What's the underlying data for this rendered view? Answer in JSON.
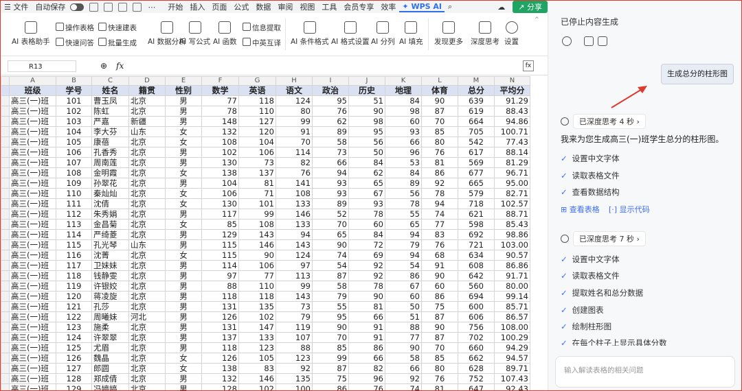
{
  "menubar": {
    "file": "文件",
    "autosave": "自动保存",
    "tabs": [
      "开始",
      "插入",
      "页面",
      "公式",
      "数据",
      "审阅",
      "视图",
      "工具",
      "会员专享",
      "效率"
    ],
    "wps_ai": "WPS AI",
    "share": "分享"
  },
  "ribbon": {
    "ai_table_assistant": "AI 表格助手",
    "operate_table": "操作表格",
    "quick_table": "快速建表",
    "quick_qa": "快速问答",
    "batch_generate": "批量生成",
    "ai_data_analysis": "AI 数据分析",
    "ai_formula": "AI 写公式",
    "ai_function": "AI 函数",
    "info_extract": "信息提取",
    "cn_en_translate": "中英互译",
    "ai_conditional_format": "AI 条件格式",
    "ai_format_setting": "AI 格式设置",
    "ai_split_column": "AI 分列",
    "ai_fill": "AI 填充",
    "discover_more": "发现更多",
    "deep_think": "深度思考",
    "beta": "Beta",
    "settings": "设置"
  },
  "formula_bar": {
    "cell_ref": "R13",
    "fx": "fx",
    "value": ""
  },
  "sheet": {
    "columns": [
      "A",
      "B",
      "C",
      "D",
      "E",
      "F",
      "G",
      "H",
      "I",
      "J",
      "K",
      "L",
      "M",
      "N"
    ],
    "headers": [
      "班级",
      "学号",
      "姓名",
      "籍贯",
      "性别",
      "数学",
      "英语",
      "语文",
      "政治",
      "历史",
      "地理",
      "体育",
      "总分",
      "平均分"
    ],
    "rows": [
      [
        "高三(一)班",
        "101",
        "曹玉凤",
        "北京",
        "男",
        "77",
        "118",
        "124",
        "95",
        "51",
        "84",
        "90",
        "639",
        "91.29"
      ],
      [
        "高三(一)班",
        "102",
        "陈虹",
        "北京",
        "男",
        "78",
        "110",
        "80",
        "76",
        "90",
        "98",
        "87",
        "619",
        "88.43"
      ],
      [
        "高三(一)班",
        "103",
        "严嘉",
        "新疆",
        "男",
        "148",
        "127",
        "99",
        "62",
        "98",
        "60",
        "70",
        "664",
        "94.86"
      ],
      [
        "高三(一)班",
        "104",
        "李大芬",
        "山东",
        "女",
        "132",
        "120",
        "91",
        "89",
        "95",
        "93",
        "85",
        "705",
        "100.71"
      ],
      [
        "高三(一)班",
        "105",
        "康蓓",
        "北京",
        "女",
        "108",
        "104",
        "70",
        "58",
        "56",
        "66",
        "80",
        "542",
        "77.43"
      ],
      [
        "高三(一)班",
        "106",
        "孔香秀",
        "北京",
        "男",
        "102",
        "106",
        "114",
        "73",
        "50",
        "96",
        "76",
        "617",
        "88.14"
      ],
      [
        "高三(一)班",
        "107",
        "周南莲",
        "北京",
        "男",
        "130",
        "73",
        "82",
        "66",
        "84",
        "53",
        "81",
        "569",
        "81.29"
      ],
      [
        "高三(一)班",
        "108",
        "金明霞",
        "北京",
        "女",
        "138",
        "137",
        "76",
        "94",
        "62",
        "84",
        "86",
        "677",
        "96.71"
      ],
      [
        "高三(一)班",
        "109",
        "孙翠花",
        "北京",
        "男",
        "104",
        "81",
        "141",
        "93",
        "65",
        "89",
        "92",
        "665",
        "95.00"
      ],
      [
        "高三(一)班",
        "110",
        "秦灿灿",
        "北京",
        "女",
        "106",
        "71",
        "108",
        "93",
        "67",
        "56",
        "78",
        "579",
        "82.71"
      ],
      [
        "高三(一)班",
        "111",
        "沈倩",
        "北京",
        "女",
        "130",
        "101",
        "133",
        "89",
        "93",
        "78",
        "94",
        "718",
        "102.57"
      ],
      [
        "高三(一)班",
        "112",
        "朱秀娟",
        "北京",
        "男",
        "117",
        "99",
        "146",
        "52",
        "78",
        "55",
        "74",
        "621",
        "88.71"
      ],
      [
        "高三(一)班",
        "113",
        "金昌菊",
        "北京",
        "女",
        "85",
        "108",
        "133",
        "70",
        "60",
        "65",
        "77",
        "598",
        "85.43"
      ],
      [
        "高三(一)班",
        "114",
        "严绮菱",
        "北京",
        "男",
        "129",
        "143",
        "94",
        "65",
        "84",
        "94",
        "83",
        "692",
        "98.86"
      ],
      [
        "高三(一)班",
        "115",
        "孔光琴",
        "山东",
        "男",
        "115",
        "146",
        "143",
        "90",
        "72",
        "79",
        "76",
        "721",
        "103.00"
      ],
      [
        "高三(一)班",
        "116",
        "沈菁",
        "北京",
        "女",
        "115",
        "90",
        "124",
        "74",
        "69",
        "94",
        "68",
        "634",
        "90.57"
      ],
      [
        "高三(一)班",
        "117",
        "卫妹妹",
        "北京",
        "男",
        "114",
        "106",
        "97",
        "54",
        "92",
        "54",
        "91",
        "608",
        "86.86"
      ],
      [
        "高三(一)班",
        "118",
        "钱静雯",
        "北京",
        "男",
        "97",
        "77",
        "113",
        "87",
        "92",
        "86",
        "90",
        "642",
        "91.71"
      ],
      [
        "高三(一)班",
        "119",
        "许银姣",
        "北京",
        "男",
        "88",
        "110",
        "99",
        "58",
        "78",
        "67",
        "60",
        "560",
        "80.00"
      ],
      [
        "高三(一)班",
        "120",
        "蒋凌旋",
        "北京",
        "男",
        "118",
        "118",
        "143",
        "79",
        "90",
        "60",
        "86",
        "694",
        "99.14"
      ],
      [
        "高三(一)班",
        "121",
        "孔莎",
        "北京",
        "男",
        "131",
        "135",
        "73",
        "55",
        "81",
        "50",
        "75",
        "600",
        "85.71"
      ],
      [
        "高三(一)班",
        "122",
        "周曦妹",
        "河北",
        "男",
        "126",
        "102",
        "79",
        "95",
        "66",
        "51",
        "87",
        "606",
        "86.57"
      ],
      [
        "高三(一)班",
        "123",
        "施柔",
        "北京",
        "男",
        "131",
        "147",
        "119",
        "90",
        "91",
        "88",
        "90",
        "756",
        "108.00"
      ],
      [
        "高三(一)班",
        "124",
        "许翠翠",
        "北京",
        "男",
        "137",
        "133",
        "107",
        "70",
        "91",
        "77",
        "87",
        "702",
        "100.29"
      ],
      [
        "高三(一)班",
        "125",
        "尤眉",
        "北京",
        "男",
        "118",
        "123",
        "88",
        "85",
        "86",
        "90",
        "70",
        "660",
        "94.29"
      ],
      [
        "高三(一)班",
        "126",
        "魏晶",
        "北京",
        "女",
        "126",
        "105",
        "123",
        "99",
        "66",
        "58",
        "85",
        "662",
        "94.57"
      ],
      [
        "高三(一)班",
        "127",
        "郎圆",
        "北京",
        "女",
        "138",
        "83",
        "92",
        "87",
        "82",
        "66",
        "80",
        "628",
        "89.71"
      ],
      [
        "高三(一)班",
        "128",
        "郑成倩",
        "北京",
        "男",
        "132",
        "146",
        "135",
        "75",
        "96",
        "92",
        "76",
        "752",
        "107.43"
      ],
      [
        "高三(一)班",
        "129",
        "冯婷婷",
        "北京",
        "男",
        "128",
        "102",
        "100",
        "86",
        "76",
        "74",
        "81",
        "647",
        "92.43"
      ]
    ]
  },
  "panel": {
    "stopped": "已停止内容生成",
    "user_message": "生成总分的柱形图",
    "think1": "已深度思考 4 秒",
    "intro": "我来为您生成高三(一)班学生总分的柱形图。",
    "steps1": [
      "设置中文字体",
      "读取表格文件",
      "查看数据结构"
    ],
    "view_table": "查看表格",
    "show_code": "显示代码",
    "think2": "已深度思考 7 秒",
    "steps2": [
      "设置中文字体",
      "读取表格文件",
      "提取姓名和总分数据",
      "创建图表",
      "绘制柱形图",
      "在每个柱子上显示具体分数"
    ],
    "input_placeholder": "输入解读表格的相关问题"
  },
  "colors": {
    "header_fill": "#d9e1f2",
    "accent": "#3b6cff",
    "arrow": "#e03a2f",
    "share": "#1fa463"
  }
}
